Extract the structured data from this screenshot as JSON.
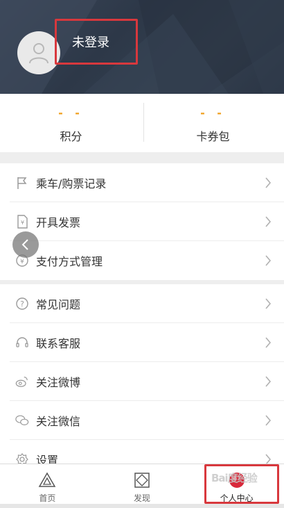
{
  "header": {
    "login_status": "未登录"
  },
  "stats": [
    {
      "value": "- -",
      "label": "积分"
    },
    {
      "value": "- -",
      "label": "卡券包"
    }
  ],
  "menu_group_1": [
    {
      "label": "乘车/购票记录",
      "icon": "flag-icon"
    },
    {
      "label": "开具发票",
      "icon": "invoice-icon"
    },
    {
      "label": "支付方式管理",
      "icon": "yuan-coin-icon"
    }
  ],
  "menu_group_2": [
    {
      "label": "常见问题",
      "icon": "question-icon"
    },
    {
      "label": "联系客服",
      "icon": "headset-icon"
    },
    {
      "label": "关注微博",
      "icon": "weibo-icon"
    },
    {
      "label": "关注微信",
      "icon": "wechat-icon"
    },
    {
      "label": "设置",
      "icon": "gear-icon"
    }
  ],
  "tabbar": [
    {
      "label": "首页",
      "icon": "home-triangle-icon"
    },
    {
      "label": "发现",
      "icon": "discover-diamond-icon"
    },
    {
      "label": "个人中心",
      "icon": "profile-icon"
    }
  ],
  "watermark": "Bai度经验",
  "colors": {
    "header_bg": "#2f3a4a",
    "accent_dash": "#f0a020",
    "highlight_box": "#d8383d",
    "active_tab": "#d8283a"
  }
}
